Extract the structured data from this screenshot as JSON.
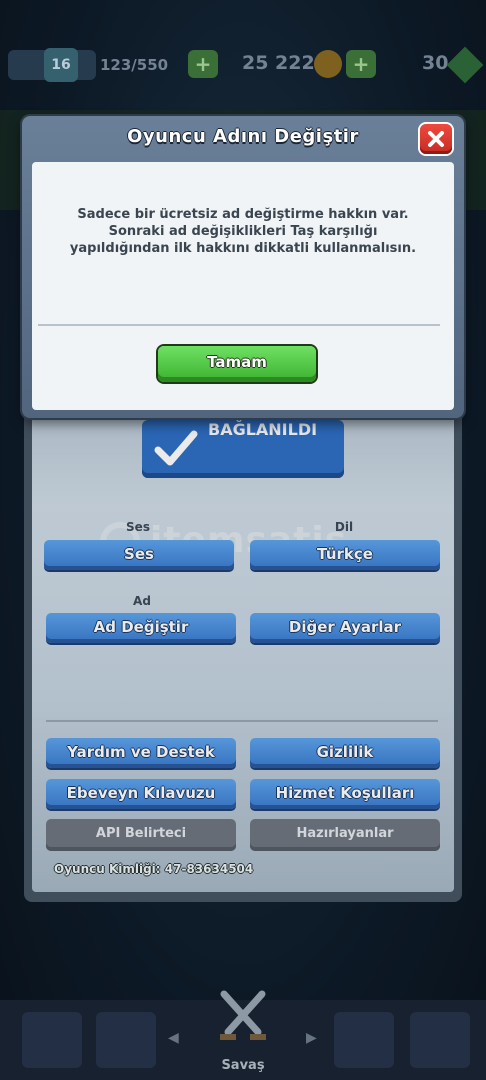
{
  "topbar": {
    "level": "16",
    "xp": "123/550",
    "gold": "25 222",
    "gems": "30"
  },
  "dialog": {
    "title": "Oyuncu Adını Değiştir",
    "message": "Sadece bir ücretsiz ad değiştirme hakkın var. Sonraki ad değişiklikleri Taş karşılığı yapıldığından ilk hakkını dikkatli kullanmalısın.",
    "ok_label": "Tamam"
  },
  "settings": {
    "connected_label": "BAĞLANILDI",
    "sound_section": "Ses",
    "sound_button": "Ses",
    "language_section": "Dil",
    "language_button": "Türkçe",
    "name_section": "Ad",
    "change_name_button": "Ad Değiştir",
    "other_settings_button": "Diğer Ayarlar",
    "help_button": "Yardım ve Destek",
    "privacy_button": "Gizlilik",
    "parents_guide_button": "Ebeveyn Kılavuzu",
    "terms_button": "Hizmet Koşulları",
    "api_token_button": "API Belirteci",
    "credits_button": "Hazırlayanlar",
    "player_id": "Oyuncu Kimliği: 47-83634504"
  },
  "watermark": "itemsatis",
  "nav": {
    "battle_label": "Savaş"
  },
  "colors": {
    "accent_blue": "#3b7cd0",
    "ok_green": "#3bb12e",
    "close_red": "#c52b22"
  }
}
